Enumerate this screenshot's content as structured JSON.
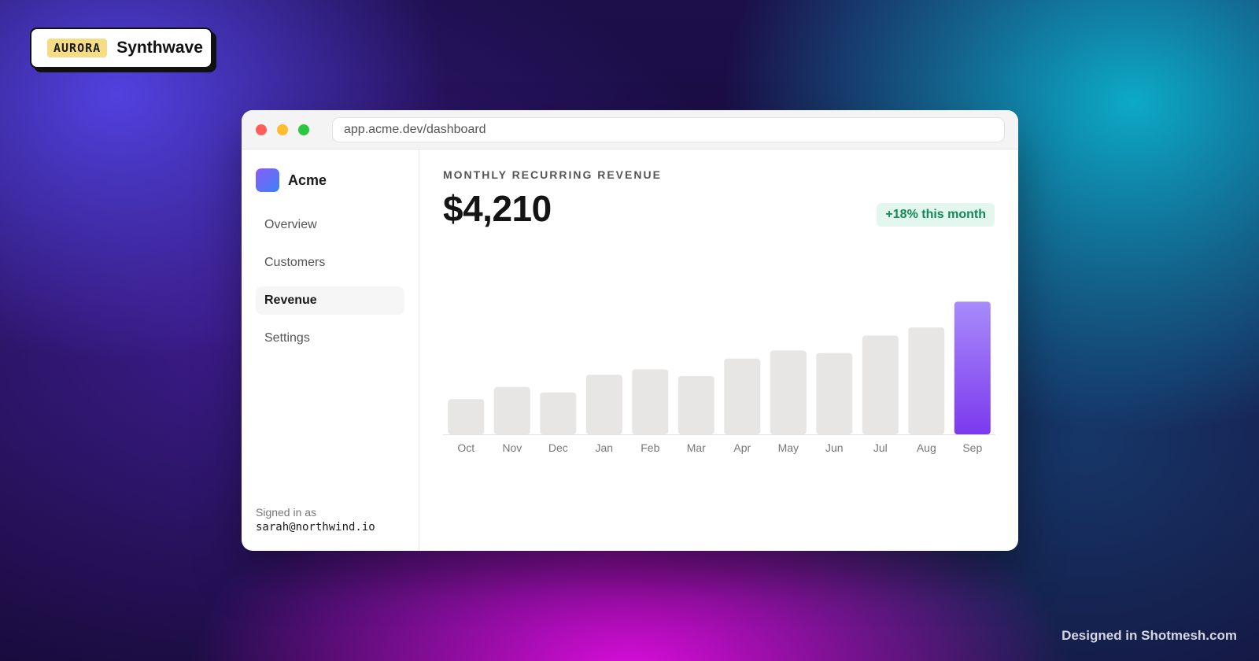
{
  "badge": {
    "tag": "AURORA",
    "name": "Synthwave"
  },
  "browser": {
    "url": "app.acme.dev/dashboard"
  },
  "app": {
    "name": "Acme",
    "nav": [
      {
        "label": "Overview",
        "active": false
      },
      {
        "label": "Customers",
        "active": false
      },
      {
        "label": "Revenue",
        "active": true
      },
      {
        "label": "Settings",
        "active": false
      }
    ],
    "signed_in_label": "Signed in as",
    "signed_in_email": "sarah@northwind.io"
  },
  "metric": {
    "label": "MONTHLY RECURRING REVENUE",
    "value": "$4,210",
    "delta": "+18% this month"
  },
  "colors": {
    "bar_default": "#e7e6e4",
    "bar_highlight_top": "#a78bfa",
    "bar_highlight_bottom": "#7c3aed",
    "delta_bg": "#e3f7ee",
    "delta_text": "#138a56"
  },
  "chart_data": {
    "type": "bar",
    "categories": [
      "Oct",
      "Nov",
      "Dec",
      "Jan",
      "Feb",
      "Mar",
      "Apr",
      "May",
      "Jun",
      "Jul",
      "Aug",
      "Sep"
    ],
    "values": [
      26,
      35,
      31,
      44,
      48,
      43,
      56,
      62,
      60,
      73,
      79,
      98
    ],
    "highlight_index": 11,
    "ylim": [
      0,
      100
    ],
    "grid": false,
    "title": "",
    "xlabel": "",
    "ylabel": ""
  },
  "footer": {
    "credit": "Designed in Shotmesh.com"
  }
}
